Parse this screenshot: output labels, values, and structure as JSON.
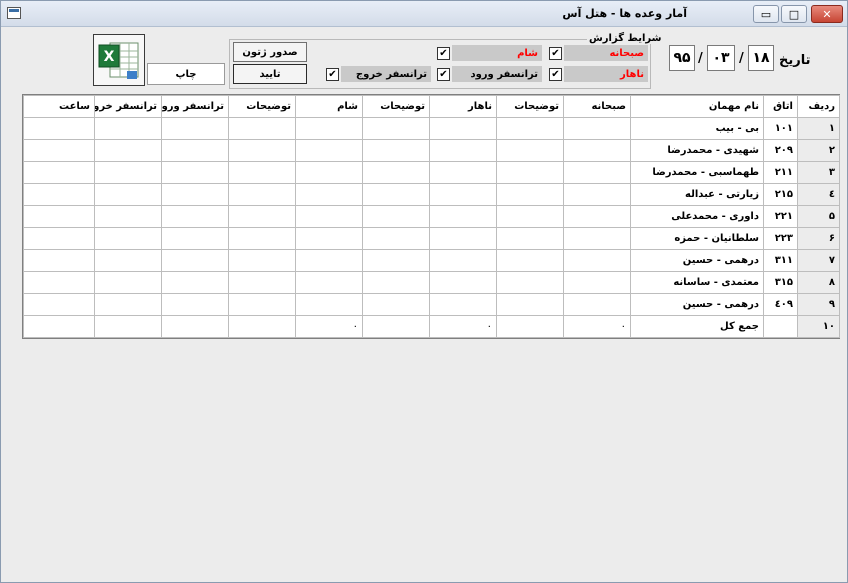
{
  "window": {
    "title": "آمار وعده ها - هتل آس",
    "min_glyph": "▭",
    "max_glyph": "□",
    "close_glyph": "✕"
  },
  "date": {
    "label": "تاریخ",
    "day": "۱۸",
    "month": "۰۳",
    "year": "۹۵",
    "separator": "/"
  },
  "report_options": {
    "title": "شرایط گزارش",
    "options": [
      {
        "label": "صبحانه",
        "checked": true,
        "color": "#ff0000"
      },
      {
        "label": "شام",
        "checked": true,
        "color": "#ff0000"
      },
      {
        "label": "ناهار",
        "checked": true,
        "color": "#ff0000"
      },
      {
        "label": "ترانسفر ورود",
        "checked": true,
        "color": "#000000"
      },
      {
        "label": "ترانسفر خروج",
        "checked": true,
        "color": "#000000"
      }
    ]
  },
  "buttons": {
    "voucher": "صدور ژتون",
    "confirm": "تایید",
    "print": "چاپ",
    "excel_icon": "excel-icon"
  },
  "grid": {
    "columns": [
      "ردیف",
      "اتاق",
      "نام مهمان",
      "صبحانه",
      "توضیحات",
      "ناهار",
      "توضیحات",
      "شام",
      "توضیحات",
      "ترانسفر ورود",
      "ترانسفر خروج",
      "ساعت"
    ],
    "rows": [
      {
        "n": "۱",
        "room": "۱۰۱",
        "guest": "بی - بیب",
        "breakfast": "",
        "lunch": "",
        "dinner": ""
      },
      {
        "n": "۲",
        "room": "۲۰۹",
        "guest": "شهیدی - محمدرضا",
        "breakfast": "",
        "lunch": "",
        "dinner": ""
      },
      {
        "n": "۳",
        "room": "۲۱۱",
        "guest": "طهماسبی - محمدرضا",
        "breakfast": "",
        "lunch": "",
        "dinner": ""
      },
      {
        "n": "٤",
        "room": "۲۱۵",
        "guest": "زیارتی - عبداله",
        "breakfast": "",
        "lunch": "",
        "dinner": ""
      },
      {
        "n": "۵",
        "room": "۲۲۱",
        "guest": "داوری - محمدعلی",
        "breakfast": "",
        "lunch": "",
        "dinner": ""
      },
      {
        "n": "۶",
        "room": "۲۲۳",
        "guest": "سلطانیان - حمزه",
        "breakfast": "",
        "lunch": "",
        "dinner": ""
      },
      {
        "n": "۷",
        "room": "۳۱۱",
        "guest": "درهمی - حسین",
        "breakfast": "",
        "lunch": "",
        "dinner": ""
      },
      {
        "n": "۸",
        "room": "۳۱۵",
        "guest": "معتمدی - ساسانه",
        "breakfast": "",
        "lunch": "",
        "dinner": ""
      },
      {
        "n": "۹",
        "room": "٤۰۹",
        "guest": "درهمی - حسین",
        "breakfast": "",
        "lunch": "",
        "dinner": ""
      },
      {
        "n": "۱۰",
        "room": "",
        "guest": "جمع کل",
        "breakfast": "۰",
        "lunch": "۰",
        "dinner": "۰"
      }
    ]
  }
}
